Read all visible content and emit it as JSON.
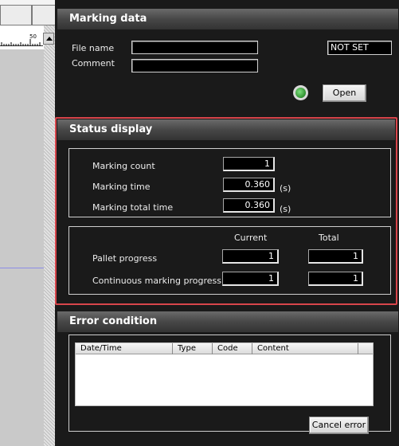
{
  "marking_data": {
    "title": "Marking data",
    "file_name_label": "File name",
    "comment_label": "Comment",
    "file_name_value": "",
    "comment_value": "",
    "status_value": "NOT SET",
    "open_button": "Open"
  },
  "status_display": {
    "title": "Status display",
    "marking_count_label": "Marking count",
    "marking_count_value": "1",
    "marking_time_label": "Marking time",
    "marking_time_value": "0.360",
    "marking_time_unit": "(s)",
    "marking_total_time_label": "Marking total time",
    "marking_total_time_value": "0.360",
    "marking_total_time_unit": "(s)",
    "col_current": "Current",
    "col_total": "Total",
    "pallet_progress_label": "Pallet progress",
    "pallet_current": "1",
    "pallet_total": "1",
    "continuous_progress_label": "Continuous marking progress",
    "continuous_current": "1",
    "continuous_total": "1"
  },
  "error_condition": {
    "title": "Error condition",
    "columns": [
      "Date/Time",
      "Type",
      "Code",
      "Content"
    ],
    "rows": [],
    "cancel_button": "Cancel error"
  },
  "ruler": {
    "label": "50"
  },
  "colors": {
    "highlight": "#d8454b",
    "indicator": "#3fae3f",
    "panel_bg": "#1a1a1a"
  }
}
